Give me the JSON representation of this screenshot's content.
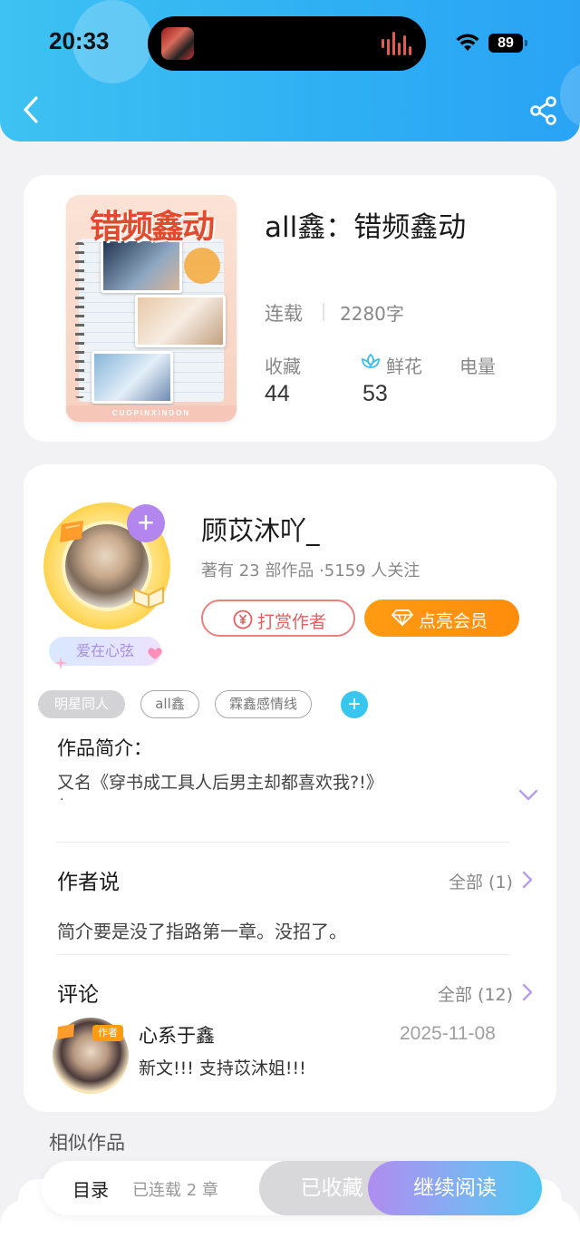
{
  "status_bar": {
    "time": "20:33",
    "battery": "89",
    "icons": [
      "wifi-icon",
      "battery-icon",
      "audio-wave-icon"
    ]
  },
  "header": {
    "icons": [
      "back-arrow-icon",
      "share-icon"
    ],
    "background_color": "#2fb0f3"
  },
  "book": {
    "title": "all鑫：错频鑫动",
    "cover_title": "错频鑫动",
    "cover_strip": "CUOPINXINDON",
    "status": "连载",
    "word_count": "2280字",
    "stats": {
      "favorites_label": "收藏",
      "favorites_value": "44",
      "flowers_label": "鲜花",
      "flowers_value": "53",
      "power_label": "电量"
    }
  },
  "author": {
    "name": "顾苡沐吖_",
    "meta": "著有 23 部作品 ·5159 人关注",
    "badge": "爱在心弦",
    "tip_button": "打赏作者",
    "vip_button": "点亮会员"
  },
  "tags": [
    "明星同人",
    "all鑫",
    "霖鑫感情线"
  ],
  "intro": {
    "title": "作品简介：",
    "text": "又名《穿书成工具人后男主却都喜欢我?!》",
    "dot": "·"
  },
  "author_says": {
    "title": "作者说",
    "all_link": "全部 (1)",
    "text": "简介要是没了指路第一章。没招了。"
  },
  "comments": {
    "title": "评论",
    "all_link": "全部 (12)",
    "items": [
      {
        "avatar_tag": "作者",
        "name": "心系于鑫",
        "date": "2025-11-08",
        "text": "新文!!! 支持苡沐姐!!!"
      }
    ]
  },
  "similar": {
    "title": "相似作品"
  },
  "bottom_bar": {
    "toc": "目录",
    "toc_sub": "已连载 2 章",
    "favorited": "已收藏",
    "continue_reading": "继续阅读",
    "accent_colors": [
      "#b08cf0",
      "#4ec6f2"
    ]
  }
}
